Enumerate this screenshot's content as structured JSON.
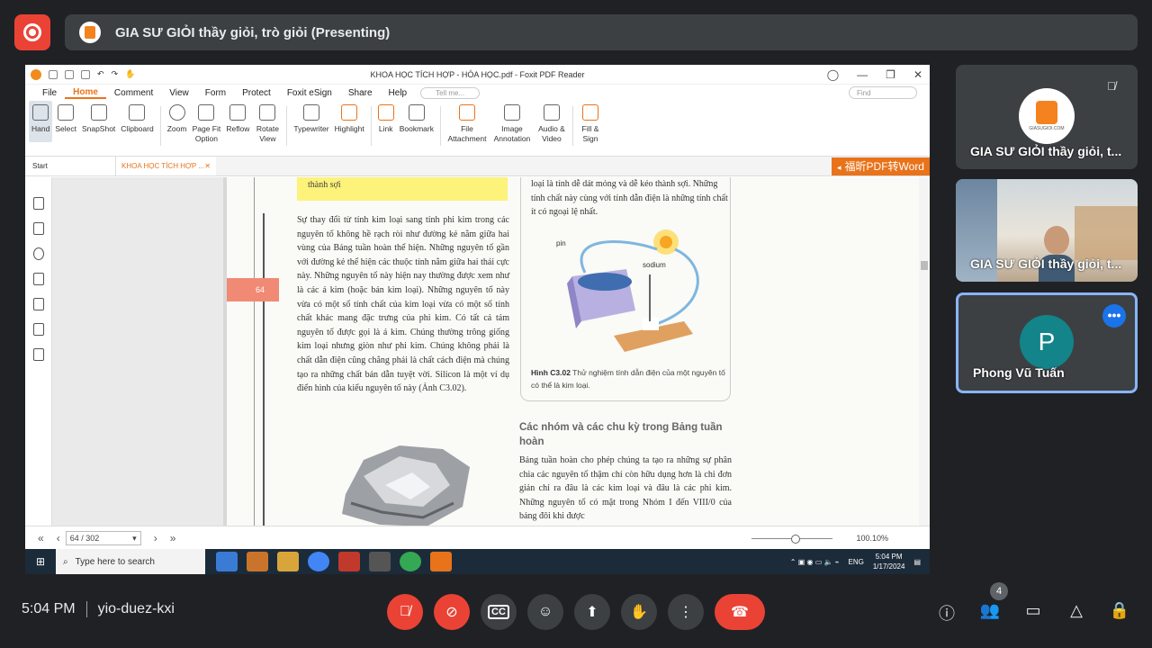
{
  "meeting": {
    "presenting_title": "GIA SƯ GIỎI thầy giỏi, trò giỏi (Presenting)",
    "time": "5:04 PM",
    "code": "yio-duez-kxi",
    "participant_count": "4"
  },
  "app": {
    "window_title": "KHOA HỌC TÍCH HỢP - HÓA HỌC.pdf - Foxit PDF Reader",
    "menu": [
      "File",
      "Home",
      "Comment",
      "View",
      "Form",
      "Protect",
      "Foxit eSign",
      "Share",
      "Help"
    ],
    "active_menu": "Home",
    "tell_me": "Tell me...",
    "find": "Find",
    "tools": {
      "hand": "Hand",
      "select": "Select",
      "snapshot": "SnapShot",
      "clipboard": "Clipboard",
      "zoom": "Zoom",
      "pagefit": "Page Fit Option",
      "reflow": "Reflow",
      "rotate": "Rotate View",
      "typewriter": "Typewriter",
      "highlight": "Highlight",
      "link": "Link",
      "bookmark": "Bookmark",
      "file_attachment": "File Attachment",
      "image_annotation": "Image Annotation",
      "audio_video": "Audio & Video",
      "fill_sign": "Fill & Sign"
    },
    "tab_start": "Start",
    "tab_doc": "KHOA HỌC TÍCH HỢP ...",
    "fuxin_banner": "福昕PDF转Word",
    "page_indicator": "64 / 302",
    "zoom": "100.10%"
  },
  "document": {
    "yellow_box": "thành sợi",
    "page_number": "64",
    "col1_text": "Sự thay đổi từ tính kim loại sang tính phi kim trong các nguyên tố không hề rạch ròi như đường kẻ nằm giữa hai vùng của Bảng tuần hoàn thể hiện. Những nguyên tố gần với đường kẻ thể hiện các thuộc tính nằm giữa hai thái cực này. Những nguyên tố này hiện nay thường được xem như là các á kim (hoặc bán kim loại). Những nguyên tố này vừa có một số tính chất của kim loại vừa có một số tính chất khác mang đặc trưng của phi kim. Có tất cả tám nguyên tố được gọi là á kim. Chúng thường trông giống kim loại nhưng giòn như phi kim. Chúng không phải là chất dẫn điện cũng chẳng phải là chất cách điện mà chúng tạo ra những chất bán dẫn tuyệt vời. Silicon là một ví dụ điển hình của kiểu nguyên tố này (Ảnh C3.02).",
    "col2_top": "loại là tính dễ dát mỏng và dễ kéo thành sợi. Những tính chất này cùng với tính dẫn điện là những tính chất ít có ngoại lệ nhất.",
    "fig_label_pin": "pin",
    "fig_label_sodium": "sodium",
    "fig_caption_bold": "Hình C3.02",
    "fig_caption": " Thử nghiệm tính dẫn điện của một nguyên tố có thể là kim loại.",
    "section_title": "Các nhóm và các chu kỳ trong Bảng tuần hoàn",
    "col2_body": "Bảng tuần hoàn cho phép chúng ta tạo ra những sự phân chia các nguyên tố thậm chí còn hữu dụng hơn là chỉ đơn giản chỉ ra đâu là các kim loại và đâu là các phi kim. Những nguyên tố có mặt trong Nhóm I đến VIII/0 của bảng đôi khi được"
  },
  "taskbar": {
    "search_placeholder": "Type here to search",
    "lang": "ENG",
    "time": "5:04 PM",
    "date": "1/17/2024"
  },
  "participants": [
    {
      "name": "GIA SƯ GIỎI thầy giỏi, t...",
      "avatar_caption": "GIASUGIOI.COM",
      "muted": true
    },
    {
      "name": "GIA SƯ GIỎI thầy giỏi, t..."
    },
    {
      "name": "Phong Vũ Tuấn",
      "initial": "P"
    }
  ],
  "colors": {
    "accent_red": "#ea4335",
    "accent_blue": "#1a73e8",
    "foxit_orange": "#e8731a",
    "meet_bg": "#202124"
  }
}
